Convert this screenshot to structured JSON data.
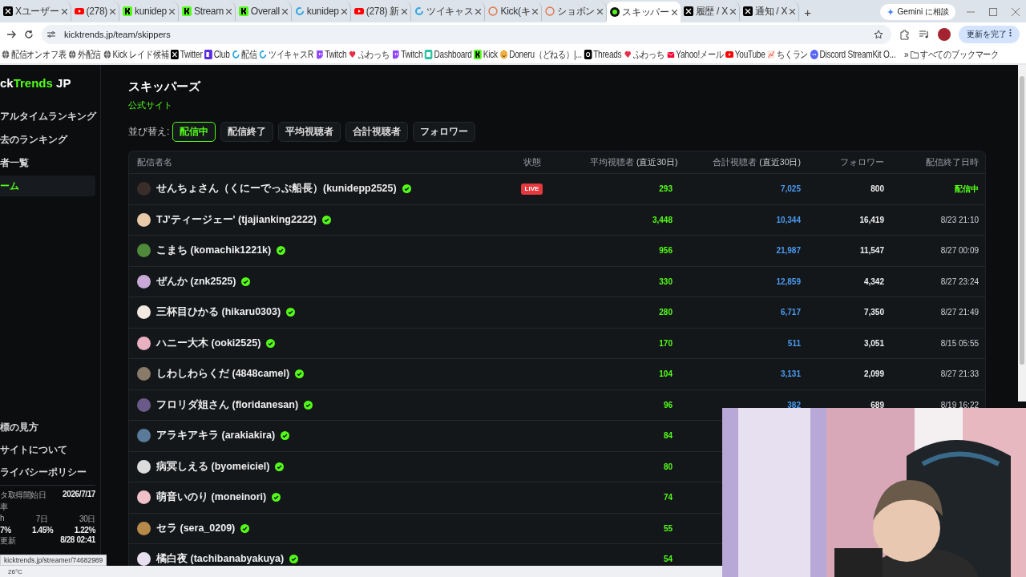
{
  "browser": {
    "tabs": [
      {
        "title": "Xユーザー",
        "kind": "x",
        "selected": false
      },
      {
        "title": "(278)",
        "kind": "youtube",
        "selected": false
      },
      {
        "title": "kunidep",
        "kind": "kick",
        "selected": false
      },
      {
        "title": "Stream",
        "kind": "kick",
        "selected": false
      },
      {
        "title": "Overall",
        "kind": "kick",
        "selected": false
      },
      {
        "title": "kunidep",
        "kind": "twitcast",
        "selected": false
      },
      {
        "title": "(278) 新",
        "kind": "youtube",
        "selected": false
      },
      {
        "title": "ツイキャス",
        "kind": "twitcast",
        "selected": false
      },
      {
        "title": "Kick(キ",
        "kind": "other",
        "selected": false
      },
      {
        "title": "ショボン",
        "kind": "other",
        "selected": false
      },
      {
        "title": "スキッパー",
        "kind": "site",
        "selected": true
      },
      {
        "title": "履歴 / X",
        "kind": "x",
        "selected": false
      },
      {
        "title": "通知 / X",
        "kind": "x",
        "selected": false
      }
    ],
    "new_tab": "+",
    "gemini": "Gemini に相談",
    "url": "kicktrends.jp/team/skippers",
    "update_button": "更新を完了",
    "bookmarks": [
      {
        "label": "配信オンオフ表",
        "kind": "globe"
      },
      {
        "label": "外配信",
        "kind": "globe"
      },
      {
        "label": "Kick レイド候補",
        "kind": "globe"
      },
      {
        "label": "Twitter",
        "kind": "x"
      },
      {
        "label": "Club",
        "kind": "club"
      },
      {
        "label": "配信",
        "kind": "twitcast"
      },
      {
        "label": "ツイキャスR",
        "kind": "twitcast"
      },
      {
        "label": "Twitch",
        "kind": "twitch"
      },
      {
        "label": "ふわっち",
        "kind": "fuwacchi"
      },
      {
        "label": "Twitch",
        "kind": "twitch"
      },
      {
        "label": "Dashboard",
        "kind": "dashboard"
      },
      {
        "label": "Kick",
        "kind": "kick"
      },
      {
        "label": "Doneru（どねる）|...",
        "kind": "doneru"
      },
      {
        "label": "Threads",
        "kind": "threads"
      },
      {
        "label": "ふわっち",
        "kind": "fuwacchi"
      },
      {
        "label": "Yahoo!メール",
        "kind": "mail"
      },
      {
        "label": "YouTube",
        "kind": "youtube"
      },
      {
        "label": "ちくラン",
        "kind": "chiku"
      },
      {
        "label": "Discord StreamKit O...",
        "kind": "discord"
      }
    ],
    "bookmarks_more": "»",
    "all_bookmarks": "すべてのブックマーク"
  },
  "sidebar": {
    "logo": {
      "part1": "ck",
      "part2": "Trends",
      "part3": "JP"
    },
    "nav": [
      {
        "label": "アルタイムランキング",
        "selected": false
      },
      {
        "label": "去のランキング",
        "selected": false
      },
      {
        "label": "者一覧",
        "selected": false
      },
      {
        "label": "ーム",
        "selected": true
      }
    ],
    "footer_links": [
      "標の見方",
      "サイトについて",
      "ライバシーポリシー"
    ],
    "stats": {
      "start_label": "タ取得開始日",
      "start_value": "2026/7/17",
      "rate_label": "率",
      "periods": [
        {
          "label": "h",
          "value": "7%"
        },
        {
          "label": "7日",
          "value": "1.45%"
        },
        {
          "label": "30日",
          "value": "1.22%"
        }
      ],
      "updated_label": "更新",
      "updated_value": "8/28 02:41"
    }
  },
  "main": {
    "title": "スキッパーズ",
    "official_link": "公式サイト",
    "sort_label": "並び替え:",
    "sort_options": [
      {
        "label": "配信中",
        "selected": true
      },
      {
        "label": "配信終了",
        "selected": false
      },
      {
        "label": "平均視聴者",
        "selected": false
      },
      {
        "label": "合計視聴者",
        "selected": false
      },
      {
        "label": "フォロワー",
        "selected": false
      }
    ],
    "table": {
      "columns": [
        {
          "label": "配信者名"
        },
        {
          "label": "状態"
        },
        {
          "label": "平均視聴者",
          "note": "(直近30日)"
        },
        {
          "label": "合計視聴者",
          "note": "(直近30日)"
        },
        {
          "label": "フォロワー"
        },
        {
          "label": "配信終了日時"
        }
      ],
      "rows": [
        {
          "name": "せんちょさん（くにーでっぷ船長）(kunidepp2525)",
          "live": true,
          "status": "LIVE",
          "avg": "293",
          "total": "7,025",
          "followers": "800",
          "ended": "配信中"
        },
        {
          "name": "TJ'ティージェー' (tjajianking2222)",
          "live": false,
          "avg": "3,448",
          "total": "10,344",
          "followers": "16,419",
          "ended": "8/23 21:10"
        },
        {
          "name": "こまち (komachik1221k)",
          "live": false,
          "avg": "956",
          "total": "21,987",
          "followers": "11,547",
          "ended": "8/27 00:09"
        },
        {
          "name": "ぜんか (znk2525)",
          "live": false,
          "avg": "330",
          "total": "12,859",
          "followers": "4,342",
          "ended": "8/27 23:24"
        },
        {
          "name": "三杯目ひかる (hikaru0303)",
          "live": false,
          "avg": "280",
          "total": "6,717",
          "followers": "7,350",
          "ended": "8/27 21:49"
        },
        {
          "name": "ハニー大木 (ooki2525)",
          "live": false,
          "avg": "170",
          "total": "511",
          "followers": "3,051",
          "ended": "8/15 05:55"
        },
        {
          "name": "しわしわらくだ (4848camel)",
          "live": false,
          "avg": "104",
          "total": "3,131",
          "followers": "2,099",
          "ended": "8/27 21:33"
        },
        {
          "name": "フロリダ姐さん (floridanesan)",
          "live": false,
          "avg": "96",
          "total": "382",
          "followers": "689",
          "ended": "8/19 16:22"
        },
        {
          "name": "アラキアキラ (arakiakira)",
          "live": false,
          "avg": "84"
        },
        {
          "name": "病冥しえる (byomeiciel)",
          "live": false,
          "avg": "80"
        },
        {
          "name": "萌音いのり (moneinori)",
          "live": false,
          "avg": "74"
        },
        {
          "name": "セラ (sera_0209)",
          "live": false,
          "avg": "55"
        },
        {
          "name": "橘白夜 (tachibanabyakuya)",
          "live": false,
          "avg": "54"
        }
      ]
    }
  },
  "status_url": "kicktrends.jp/streamer/74682989",
  "taskbar": {
    "weather": "26°C"
  }
}
